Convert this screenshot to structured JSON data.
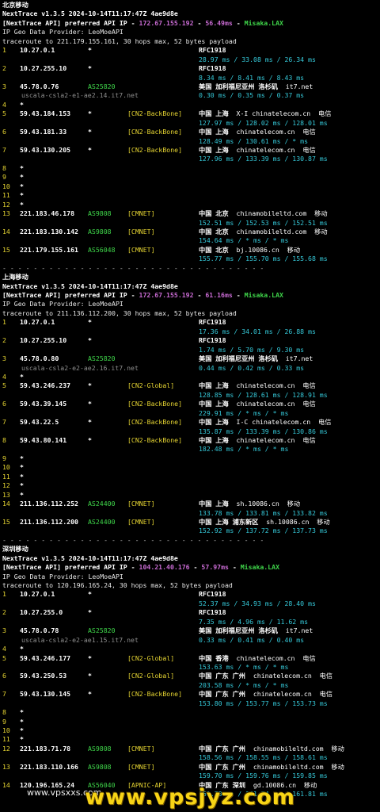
{
  "colors": {
    "background": "#000000",
    "hop": "#e5d432",
    "ip": "#ffffff",
    "asn": "#3fd64a",
    "tag": "#e5d432",
    "rtt": "#35c8d8",
    "rfc": "#ffffff",
    "host": "#8e8e8e",
    "api_ip": "#c96bd3",
    "misaka": "#3fd64a"
  },
  "sections": [
    {
      "title": "北京移动",
      "version": "NextTrace v1.3.5 2024-10-14T11:17:47Z 4ae9d8e",
      "api_prefix": "[NextTrace API] preferred API IP - ",
      "api_ip": "172.67.155.192",
      "api_latency": "56.49ms",
      "api_node": "Misaka.LAX",
      "geo_provider": "IP Geo Data Provider: LeoMoeAPI",
      "traceroute": "traceroute to 221.179.155.161, 30 hops max, 52 bytes payload",
      "hops": [
        {
          "n": "1",
          "ip": "10.27.0.1",
          "asn": "*",
          "tag": "",
          "geo": "RFC1918",
          "domain": "",
          "rtt": "28.97 ms / 33.08 ms / 26.34 ms",
          "host": ""
        },
        {
          "n": "2",
          "ip": "10.27.255.10",
          "asn": "*",
          "tag": "",
          "geo": "RFC1918",
          "domain": "",
          "rtt": "8.34 ms / 8.41 ms / 8.43 ms",
          "host": ""
        },
        {
          "n": "3",
          "ip": "45.78.0.76",
          "asn": "AS25820",
          "tag": "",
          "geo": "美国 加利福尼亚州 洛杉矶",
          "domain": "it7.net",
          "rtt": "0.30 ms / 0.35 ms / 0.37 ms",
          "host": "uscala-csla2-e1-ae2.14.it7.net"
        },
        {
          "n": "4",
          "ip": "*",
          "asn": "",
          "tag": "",
          "geo": "",
          "domain": "",
          "rtt": "",
          "host": ""
        },
        {
          "n": "5",
          "ip": "59.43.184.153",
          "asn": "*",
          "tag": "[CN2-BackBone]",
          "geo": "中国 上海",
          "domain": "X-I chinatelecom.cn  电信",
          "rtt": "127.97 ms / 128.02 ms / 128.01 ms",
          "host": ""
        },
        {
          "n": "6",
          "ip": "59.43.181.33",
          "asn": "*",
          "tag": "[CN2-BackBone]",
          "geo": "中国 上海",
          "domain": "chinatelecom.cn  电信",
          "rtt": "128.49 ms / 130.61 ms / * ms",
          "host": ""
        },
        {
          "n": "7",
          "ip": "59.43.130.205",
          "asn": "*",
          "tag": "[CN2-BackBone]",
          "geo": "中国 上海",
          "domain": "chinatelecom.cn  电信",
          "rtt": "127.96 ms / 133.39 ms / 130.87 ms",
          "host": ""
        },
        {
          "n": "8",
          "ip": "*",
          "asn": "",
          "tag": "",
          "geo": "",
          "domain": "",
          "rtt": "",
          "host": ""
        },
        {
          "n": "9",
          "ip": "*",
          "asn": "",
          "tag": "",
          "geo": "",
          "domain": "",
          "rtt": "",
          "host": ""
        },
        {
          "n": "10",
          "ip": "*",
          "asn": "",
          "tag": "",
          "geo": "",
          "domain": "",
          "rtt": "",
          "host": ""
        },
        {
          "n": "11",
          "ip": "*",
          "asn": "",
          "tag": "",
          "geo": "",
          "domain": "",
          "rtt": "",
          "host": ""
        },
        {
          "n": "12",
          "ip": "*",
          "asn": "",
          "tag": "",
          "geo": "",
          "domain": "",
          "rtt": "",
          "host": ""
        },
        {
          "n": "13",
          "ip": "221.183.46.178",
          "asn": "AS9808",
          "tag": "[CMNET]",
          "geo": "中国 北京",
          "domain": "chinamobileltd.com  移动",
          "rtt": "152.51 ms / 152.53 ms / 152.51 ms",
          "host": ""
        },
        {
          "n": "14",
          "ip": "221.183.130.142",
          "asn": "AS9808",
          "tag": "[CMNET]",
          "geo": "中国 北京",
          "domain": "chinamobileltd.com  移动",
          "rtt": "154.64 ms / * ms / * ms",
          "host": ""
        },
        {
          "n": "15",
          "ip": "221.179.155.161",
          "asn": "AS56048",
          "tag": "[CMNET]",
          "geo": "中国 北京",
          "domain": "bj.10086.cn  移动",
          "rtt": "155.77 ms / 155.70 ms / 155.68 ms",
          "host": ""
        }
      ]
    },
    {
      "title": "上海移动",
      "version": "NextTrace v1.3.5 2024-10-14T11:17:47Z 4ae9d8e",
      "api_prefix": "[NextTrace API] preferred API IP - ",
      "api_ip": "172.67.155.192",
      "api_latency": "61.16ms",
      "api_node": "Misaka.LAX",
      "geo_provider": "IP Geo Data Provider: LeoMoeAPI",
      "traceroute": "traceroute to 211.136.112.200, 30 hops max, 52 bytes payload",
      "hops": [
        {
          "n": "1",
          "ip": "10.27.0.1",
          "asn": "*",
          "tag": "",
          "geo": "RFC1918",
          "domain": "",
          "rtt": "17.36 ms / 34.01 ms / 26.88 ms",
          "host": ""
        },
        {
          "n": "2",
          "ip": "10.27.255.10",
          "asn": "*",
          "tag": "",
          "geo": "RFC1918",
          "domain": "",
          "rtt": "1.74 ms / 5.70 ms / 9.30 ms",
          "host": ""
        },
        {
          "n": "3",
          "ip": "45.78.0.80",
          "asn": "AS25820",
          "tag": "",
          "geo": "美国 加利福尼亚州 洛杉矶",
          "domain": "it7.net",
          "rtt": "0.44 ms / 0.42 ms / 0.33 ms",
          "host": "uscala-csla2-e2-ae2.16.it7.net"
        },
        {
          "n": "4",
          "ip": "*",
          "asn": "",
          "tag": "",
          "geo": "",
          "domain": "",
          "rtt": "",
          "host": ""
        },
        {
          "n": "5",
          "ip": "59.43.246.237",
          "asn": "*",
          "tag": "[CN2-Global]",
          "geo": "中国 上海",
          "domain": "chinatelecom.cn  电信",
          "rtt": "128.85 ms / 128.61 ms / 128.91 ms",
          "host": ""
        },
        {
          "n": "6",
          "ip": "59.43.39.145",
          "asn": "*",
          "tag": "[CN2-BackBone]",
          "geo": "中国 上海",
          "domain": "chinatelecom.cn  电信",
          "rtt": "229.91 ms / * ms / * ms",
          "host": ""
        },
        {
          "n": "7",
          "ip": "59.43.22.5",
          "asn": "*",
          "tag": "[CN2-BackBone]",
          "geo": "中国 上海",
          "domain": "I-C chinatelecom.cn  电信",
          "rtt": "135.87 ms / 133.39 ms / 130.86 ms",
          "host": ""
        },
        {
          "n": "8",
          "ip": "59.43.80.141",
          "asn": "*",
          "tag": "[CN2-BackBone]",
          "geo": "中国 上海",
          "domain": "chinatelecom.cn  电信",
          "rtt": "182.48 ms / * ms / * ms",
          "host": ""
        },
        {
          "n": "9",
          "ip": "*",
          "asn": "",
          "tag": "",
          "geo": "",
          "domain": "",
          "rtt": "",
          "host": ""
        },
        {
          "n": "10",
          "ip": "*",
          "asn": "",
          "tag": "",
          "geo": "",
          "domain": "",
          "rtt": "",
          "host": ""
        },
        {
          "n": "11",
          "ip": "*",
          "asn": "",
          "tag": "",
          "geo": "",
          "domain": "",
          "rtt": "",
          "host": ""
        },
        {
          "n": "12",
          "ip": "*",
          "asn": "",
          "tag": "",
          "geo": "",
          "domain": "",
          "rtt": "",
          "host": ""
        },
        {
          "n": "13",
          "ip": "*",
          "asn": "",
          "tag": "",
          "geo": "",
          "domain": "",
          "rtt": "",
          "host": ""
        },
        {
          "n": "14",
          "ip": "211.136.112.252",
          "asn": "AS24400",
          "tag": "[CMNET]",
          "geo": "中国 上海",
          "domain": "sh.10086.cn  移动",
          "rtt": "133.78 ms / 133.81 ms / 133.82 ms",
          "host": ""
        },
        {
          "n": "15",
          "ip": "211.136.112.200",
          "asn": "AS24400",
          "tag": "[CMNET]",
          "geo": "中国 上海 浦东新区",
          "domain": "sh.10086.cn  移动",
          "rtt": "152.92 ms / 137.72 ms / 137.73 ms",
          "host": ""
        }
      ]
    },
    {
      "title": "深圳移动",
      "version": "NextTrace v1.3.5 2024-10-14T11:17:47Z 4ae9d8e",
      "api_prefix": "[NextTrace API] preferred API IP - ",
      "api_ip": "104.21.40.176",
      "api_latency": "57.97ms",
      "api_node": "Misaka.LAX",
      "geo_provider": "IP Geo Data Provider: LeoMoeAPI",
      "traceroute": "traceroute to 120.196.165.24, 30 hops max, 52 bytes payload",
      "hops": [
        {
          "n": "1",
          "ip": "10.27.0.1",
          "asn": "*",
          "tag": "",
          "geo": "RFC1918",
          "domain": "",
          "rtt": "52.37 ms / 34.93 ms / 28.40 ms",
          "host": ""
        },
        {
          "n": "2",
          "ip": "10.27.255.0",
          "asn": "*",
          "tag": "",
          "geo": "RFC1918",
          "domain": "",
          "rtt": "7.35 ms / 4.96 ms / 11.62 ms",
          "host": ""
        },
        {
          "n": "3",
          "ip": "45.78.0.78",
          "asn": "AS25820",
          "tag": "",
          "geo": "美国 加利福尼亚州 洛杉矶",
          "domain": "it7.net",
          "rtt": "0.33 ms / 0.41 ms / 0.40 ms",
          "host": "uscala-csla2-e2-ae1.15.it7.net"
        },
        {
          "n": "4",
          "ip": "*",
          "asn": "",
          "tag": "",
          "geo": "",
          "domain": "",
          "rtt": "",
          "host": ""
        },
        {
          "n": "5",
          "ip": "59.43.246.177",
          "asn": "*",
          "tag": "[CN2-Global]",
          "geo": "中国 香港",
          "domain": "chinatelecom.cn  电信",
          "rtt": "153.63 ms / * ms / * ms",
          "host": ""
        },
        {
          "n": "6",
          "ip": "59.43.250.53",
          "asn": "*",
          "tag": "[CN2-Global]",
          "geo": "中国 广东 广州",
          "domain": "chinatelecom.cn  电信",
          "rtt": "203.58 ms / * ms / * ms",
          "host": ""
        },
        {
          "n": "7",
          "ip": "59.43.130.145",
          "asn": "*",
          "tag": "[CN2-BackBone]",
          "geo": "中国 广东 广州",
          "domain": "chinatelecom.cn  电信",
          "rtt": "153.80 ms / 153.77 ms / 153.73 ms",
          "host": ""
        },
        {
          "n": "8",
          "ip": "*",
          "asn": "",
          "tag": "",
          "geo": "",
          "domain": "",
          "rtt": "",
          "host": ""
        },
        {
          "n": "9",
          "ip": "*",
          "asn": "",
          "tag": "",
          "geo": "",
          "domain": "",
          "rtt": "",
          "host": ""
        },
        {
          "n": "10",
          "ip": "*",
          "asn": "",
          "tag": "",
          "geo": "",
          "domain": "",
          "rtt": "",
          "host": ""
        },
        {
          "n": "11",
          "ip": "*",
          "asn": "",
          "tag": "",
          "geo": "",
          "domain": "",
          "rtt": "",
          "host": ""
        },
        {
          "n": "12",
          "ip": "221.183.71.78",
          "asn": "AS9808",
          "tag": "[CMNET]",
          "geo": "中国 广东 广州",
          "domain": "chinamobileltd.com  移动",
          "rtt": "158.56 ms / 158.55 ms / 158.61 ms",
          "host": ""
        },
        {
          "n": "13",
          "ip": "221.183.110.166",
          "asn": "AS9808",
          "tag": "[CMNET]",
          "geo": "中国 广东 广州",
          "domain": "chinamobileltd.com  移动",
          "rtt": "159.70 ms / 159.76 ms / 159.85 ms",
          "host": ""
        },
        {
          "n": "14",
          "ip": "120.196.165.24",
          "asn": "AS56040",
          "tag": "[APNIC-AP]",
          "geo": "中国 广东 深圳",
          "domain": "gd.10086.cn  移动",
          "rtt": "161.73 ms / 161.74 ms / 161.81 ms",
          "host": ""
        }
      ]
    }
  ],
  "separator": "- - - - - - - - - - - - - - - - - - - - - - - - - - - - - - - - - -",
  "watermark": "www.vpsxxs.com",
  "logo": "www.vpsjyz.com"
}
